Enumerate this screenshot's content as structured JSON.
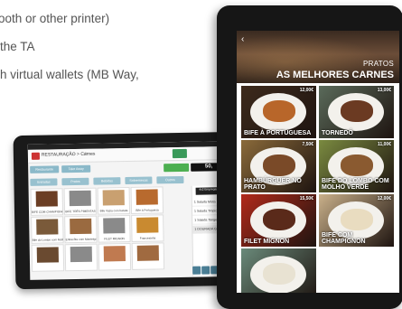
{
  "bullets": [
    "ooth or other printer)",
    "the TA",
    "h virtual wallets (MB Way,"
  ],
  "small_tablet": {
    "status": "4:37",
    "title": "RESTAURAÇÃO > Carnes",
    "search_icon": "search-icon",
    "tabs": [
      "Restaurante",
      "Take Away"
    ],
    "amount": "50,",
    "categories": [
      "Entradas",
      "Pratos",
      "Bebidas",
      "Sobremesas",
      "Outros"
    ],
    "order_header": "4x2 Empregado",
    "order_items": [
      "1 Salada Mista",
      "1 Salada Tropical",
      "1 Salada Tangerina",
      "1 DOURADA GRELHADA"
    ],
    "items": [
      {
        "label": "BIFE COM CHAMPIGNON",
        "color": "#6b3e24"
      },
      {
        "label": "BIFE TRÊS PIMENTAS",
        "color": "#8a8a8a"
      },
      {
        "label": "Bife Vazia com batata",
        "color": "#c9a070"
      },
      {
        "label": "Bife à Portuguesa",
        "color": "#b86a2e"
      },
      {
        "label": "Bife do Lombo com Molho Verde",
        "color": "#7a5a3a"
      },
      {
        "label": "Entrecôte com Manteiga",
        "color": "#9a6a40"
      },
      {
        "label": "FILET MIGNON",
        "color": "#8a8a8a"
      },
      {
        "label": "Francesinha",
        "color": "#c98a30"
      },
      {
        "label": "",
        "color": "#6a4a30"
      },
      {
        "label": "",
        "color": "#8a8a8a"
      },
      {
        "label": "",
        "color": "#c07a50"
      },
      {
        "label": "",
        "color": "#a06a40"
      }
    ]
  },
  "big_tablet": {
    "back_icon": "chevron-left-icon",
    "section": "PRATOS",
    "title": "AS MELHORES CARNES",
    "dishes": [
      {
        "name": "BIFE À PORTUGUESA",
        "price": "12,00€",
        "bg": "#3d2a1c",
        "food": "#b8662a"
      },
      {
        "name": "TORNEDÓ",
        "price": "13,00€",
        "bg": "#5a6a5a",
        "food": "#6b3a22"
      },
      {
        "name": "HAMBÚRGUER NO PRATO",
        "price": "7,50€",
        "bg": "#8a6a3a",
        "food": "#7a4a28"
      },
      {
        "name": "BIFE DO LOMBO COM MOLHO VERDE",
        "price": "11,00€",
        "bg": "#7a8a40",
        "food": "#8a5a30"
      },
      {
        "name": "FILET MIGNON",
        "price": "15,50€",
        "bg": "#b12a1a",
        "food": "#5a2a1a"
      },
      {
        "name": "BIFE COM CHAMPIGNON",
        "price": "12,00€",
        "bg": "#c9b08a",
        "food": "#e9dcc0"
      },
      {
        "name": "",
        "price": "",
        "bg": "#6a8a7a",
        "food": "#e8e2d2"
      }
    ]
  }
}
